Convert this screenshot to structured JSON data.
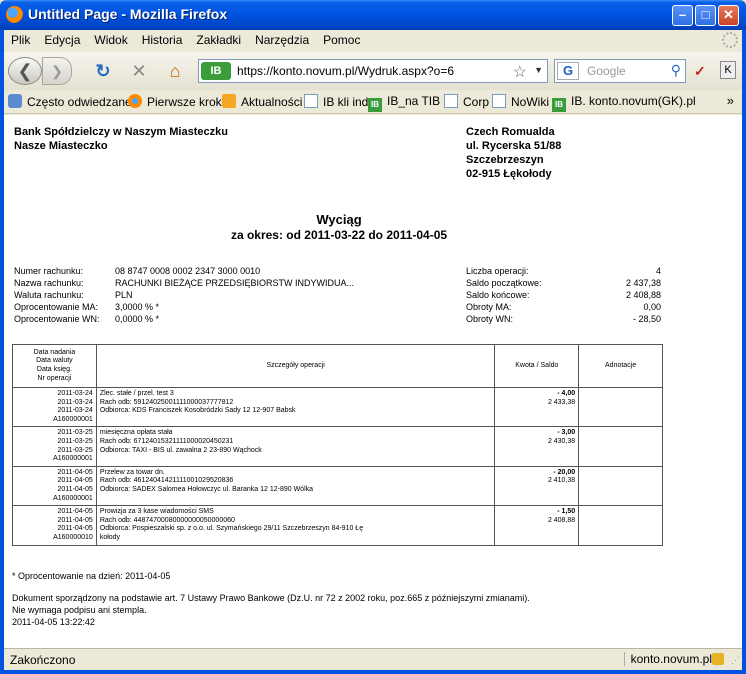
{
  "window": {
    "title": "Untitled Page - Mozilla Firefox",
    "minimize": "–",
    "maximize": "□",
    "close": "✕"
  },
  "menu": [
    "Plik",
    "Edycja",
    "Widok",
    "Historia",
    "Zakładki",
    "Narzędzia",
    "Pomoc"
  ],
  "nav": {
    "url": "https://konto.novum.pl/Wydruk.aspx?o=6",
    "site_badge": "IB",
    "search_placeholder": "Google",
    "search_engine": "G"
  },
  "bookmarks": [
    {
      "label": "Często odwiedzane",
      "icon": "cog-icon"
    },
    {
      "label": "Pierwsze kroki",
      "icon": "firefox-icon"
    },
    {
      "label": "Aktualności",
      "icon": "rss-icon"
    },
    {
      "label": "IB kli ind",
      "icon": "page-icon"
    },
    {
      "label": "IB_na TIB",
      "icon": "ib-icon"
    },
    {
      "label": "Corp",
      "icon": "page-icon"
    },
    {
      "label": "NoWiki",
      "icon": "page-icon"
    },
    {
      "label": "IB. konto.novum(GK).pl",
      "icon": "ib-icon"
    }
  ],
  "doc": {
    "bank_name": "Bank Spółdzielczy w Naszym Miasteczku",
    "bank_city": "Nasze Miasteczko",
    "customer": [
      "Czech Romualda",
      "ul. Rycerska 51/88",
      "Szczebrzeszyn",
      "02-915 Łękołody"
    ],
    "title": "Wyciąg",
    "period": "za okres: od 2011-03-22 do 2011-04-05",
    "info_left": [
      {
        "k": "Numer rachunku:",
        "v": "08 8747 0008 0002 2347 3000 0010"
      },
      {
        "k": "Nazwa rachunku:",
        "v": "RACHUNKI BIEŻĄCE PRZEDSIĘBIORSTW INDYWIDUA..."
      },
      {
        "k": "Waluta rachunku:",
        "v": "PLN"
      },
      {
        "k": "Oprocentowanie MA:",
        "v": "3,0000  % *"
      },
      {
        "k": "Oprocentowanie WN:",
        "v": "0,0000  % *"
      }
    ],
    "info_right": [
      {
        "k": "Liczba operacji:",
        "v": "4"
      },
      {
        "k": "Saldo początkowe:",
        "v": "2 437,38"
      },
      {
        "k": "Saldo końcowe:",
        "v": "2 408,88"
      },
      {
        "k": "Obroty MA:",
        "v": "0,00"
      },
      {
        "k": "Obroty WN:",
        "v": "- 28,50"
      }
    ],
    "table_headers": {
      "dates": [
        "Data nadania",
        "Data waluty",
        "Data księg.",
        "Nr operacji"
      ],
      "details": "Szczegóły operacji",
      "amount": "Kwota / Saldo",
      "notes": "Adnotacje"
    },
    "operations": [
      {
        "dates": [
          "2011-03-24",
          "2011-03-24",
          "2011-03-24",
          "A160000001"
        ],
        "details": [
          "Zlec. stałe / przel. test 3",
          "Rach odb: 59124025001111000037777812",
          "Odbiorca: KDS Franciszek Kosobródzki Sady 12 12-907 Babsk"
        ],
        "amount": "- 4,00",
        "balance": "2 433,38",
        "note": ""
      },
      {
        "dates": [
          "2011-03-25",
          "2011-03-25",
          "2011-03-25",
          "A160000001"
        ],
        "details": [
          "miesięczna opłata stała",
          "Rach odb: 67124015321111000020450231",
          "Odbiorca: TAXI - BIS ul. zawalna 2 23-890 Wąchock"
        ],
        "amount": "- 3,00",
        "balance": "2 430,38",
        "note": ""
      },
      {
        "dates": [
          "2011-04-05",
          "2011-04-05",
          "2011-04-05",
          "A160000001"
        ],
        "details": [
          "Przelew za towar dn.",
          "Rach odb: 46124041421111001029520836",
          "Odbiorca: SADEX Salomea Hołowczyc ul. Baranka 12 12-890 Wólka"
        ],
        "amount": "- 20,00",
        "balance": "2 410,38",
        "note": ""
      },
      {
        "dates": [
          "2011-04-05",
          "2011-04-05",
          "2011-04-05",
          "A160000010"
        ],
        "details": [
          "Prowizja za 3 kase wiadomości SMS",
          "Rach odb: 44874700080000000050000060",
          "Odbiorca: Pospieszalski sp. z o.o. ul. Szymańskiego 29/11 Szczebrzeszyn 84-910 Łę",
          "kołody"
        ],
        "amount": "- 1,50",
        "balance": "2 408,88",
        "note": ""
      }
    ],
    "footnote": "* Oprocentowanie na dzień: 2011-04-05",
    "legal": [
      "Dokument sporządzony na podstawie art. 7 Ustawy Prawo Bankowe (Dz.U. nr 72 z 2002 roku, poz.665 z późniejszymi zmianami).",
      "Nie wymaga podpisu ani stempla."
    ],
    "printed": "2011-04-05 13:22:42"
  },
  "status": {
    "text": "Zakończono",
    "domain": "konto.novum.pl"
  }
}
